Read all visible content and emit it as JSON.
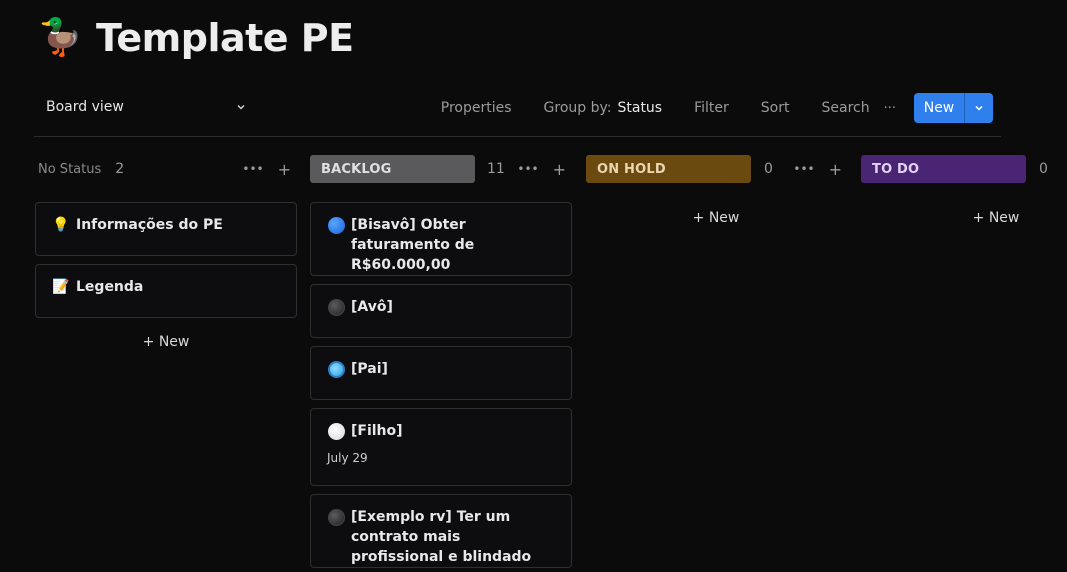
{
  "page": {
    "icon": "duck-emoji",
    "icon_glyph": "🦆",
    "title": "Template PE"
  },
  "toolbar": {
    "view_label": "Board view",
    "properties": "Properties",
    "group_by_label": "Group by:",
    "group_by_value": "Status",
    "filter": "Filter",
    "sort": "Sort",
    "search": "Search",
    "more": "···",
    "new_label": "New"
  },
  "columns": {
    "no_status": {
      "label": "No Status",
      "count": "2",
      "add_new": "+ New",
      "cards": [
        {
          "icon": "lightbulb-icon",
          "glyph": "💡",
          "title": "Informações do PE"
        },
        {
          "icon": "memo-icon",
          "glyph": "📝",
          "title": "Legenda"
        }
      ]
    },
    "backlog": {
      "label": "BACKLOG",
      "count": "11",
      "color": "#5a5a5c",
      "cards": [
        {
          "icon": "blue-circle-icon",
          "title": "[Bisavô] Obter faturamento de R$60.000,00"
        },
        {
          "icon": "black-circle-icon",
          "title": "[Avô]"
        },
        {
          "icon": "light-blue-circle-icon",
          "title": "[Pai]"
        },
        {
          "icon": "white-circle-icon",
          "title": "[Filho]",
          "date": "July 29"
        },
        {
          "icon": "black-circle-icon",
          "title": "[Exemplo rv] Ter um contrato mais profissional e blindado"
        }
      ]
    },
    "on_hold": {
      "label": "ON HOLD",
      "count": "0",
      "color": "#6b4a0f",
      "add_new": "+ New"
    },
    "to_do": {
      "label": "TO DO",
      "count": "0",
      "color": "#4a2574",
      "add_new": "+ New"
    }
  },
  "colors": {
    "accent": "#2f80ed",
    "backlog": "#5a5a5c",
    "on_hold": "#6b4a0f",
    "to_do": "#4a2574"
  }
}
